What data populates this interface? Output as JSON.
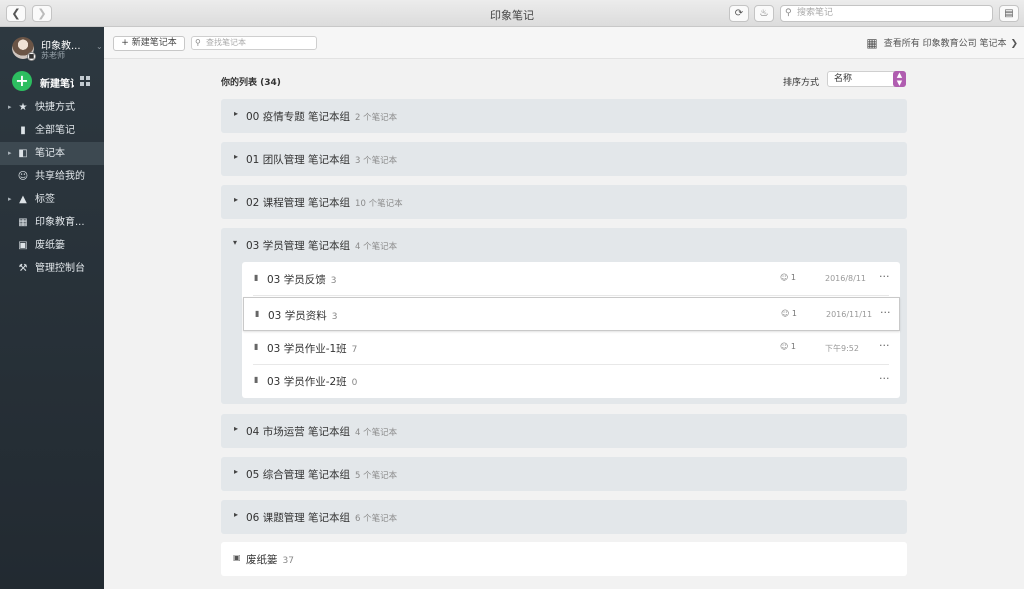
{
  "app": {
    "title": "印象笔记"
  },
  "titlebar": {
    "search_placeholder": "搜索笔记"
  },
  "account": {
    "name": "印象教...",
    "subtitle": "苏老师"
  },
  "sidebar": {
    "new_note_label": "新建笔记",
    "items": [
      {
        "label": "快捷方式",
        "icon": "star-icon",
        "has_caret": true
      },
      {
        "label": "全部笔记",
        "icon": "note-icon",
        "has_caret": false
      },
      {
        "label": "笔记本",
        "icon": "notebook-icon",
        "has_caret": true,
        "active": true
      },
      {
        "label": "共享给我的",
        "icon": "people-icon",
        "has_caret": false
      },
      {
        "label": "标签",
        "icon": "tag-icon",
        "has_caret": true
      },
      {
        "label": "印象教育...",
        "icon": "building-icon",
        "has_caret": false
      },
      {
        "label": "废纸篓",
        "icon": "trash-icon",
        "has_caret": false
      },
      {
        "label": "管理控制台",
        "icon": "wrench-icon",
        "has_caret": false
      }
    ]
  },
  "toolbar": {
    "new_notebook_label": "+ 新建笔记本",
    "search_placeholder": "查找笔记本",
    "view_all_label": "查看所有 印象教育公司 笔记本"
  },
  "main": {
    "list_title": "你的列表 (34)",
    "sort_label": "排序方式",
    "sort_value": "名称",
    "groups": [
      {
        "name": "00 疫情专题 笔记本组",
        "count": "2 个笔记本"
      },
      {
        "name": "01 团队管理 笔记本组",
        "count": "3 个笔记本"
      },
      {
        "name": "02 课程管理 笔记本组",
        "count": "10 个笔记本"
      },
      {
        "name": "03 学员管理 笔记本组",
        "count": "4 个笔记本"
      },
      {
        "name": "04 市场运营 笔记本组",
        "count": "4 个笔记本"
      },
      {
        "name": "05 综合管理 笔记本组",
        "count": "5 个笔记本"
      },
      {
        "name": "06 课题管理 笔记本组",
        "count": "6 个笔记本"
      }
    ],
    "expanded_notebooks": [
      {
        "name": "03 学员反馈",
        "count": "3",
        "shared": "1",
        "date": "2016/8/11"
      },
      {
        "name": "03 学员资料",
        "count": "3",
        "shared": "1",
        "date": "2016/11/11"
      },
      {
        "name": "03 学员作业-1班",
        "count": "7",
        "shared": "1",
        "date": "下午9:52"
      },
      {
        "name": "03 学员作业-2班",
        "count": "0",
        "shared": "",
        "date": ""
      }
    ],
    "trash": {
      "name": "废纸篓",
      "count": "37"
    }
  }
}
